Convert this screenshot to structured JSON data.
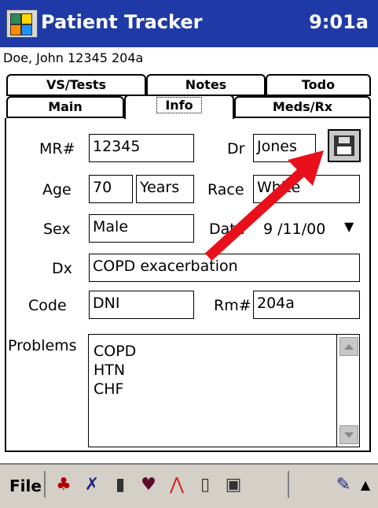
{
  "app": {
    "name": "Patient Tracker",
    "time": "9:01a"
  },
  "patient_line": "Doe, John 12345 204a",
  "tabs": {
    "row1": [
      "VS/Tests",
      "Notes",
      "Todo"
    ],
    "row2": [
      "Main",
      "Info",
      "Meds/Rx"
    ],
    "active": "Info"
  },
  "form": {
    "mr_label": "MR#",
    "mr_value": "12345",
    "dr_label": "Dr",
    "dr_value": "Jones",
    "age_label": "Age",
    "age_value": "70",
    "age_unit": "Years",
    "race_label": "Race",
    "race_value": "White",
    "sex_label": "Sex",
    "sex_value": "Male",
    "date_label": "Date",
    "date_value": "9 /11/00",
    "dx_label": "Dx",
    "dx_value": "COPD exacerbation",
    "code_label": "Code",
    "code_value": "DNI",
    "rm_label": "Rm#",
    "rm_value": "204a",
    "problems_label": "Problems",
    "problems": [
      "COPD",
      "HTN",
      "CHF"
    ]
  },
  "bottom": {
    "file_label": "File"
  },
  "colors": {
    "title_bg": "#1f3aa6",
    "arrow": "#e8101a",
    "toolbar_bg": "#d4d0c8"
  },
  "icons": [
    "save-icon",
    "person-icon",
    "chart-icon",
    "test-tube-icon",
    "heart-icon",
    "ekg-icon",
    "document-icon",
    "book-icon",
    "pen-icon",
    "chevron-up-icon"
  ]
}
